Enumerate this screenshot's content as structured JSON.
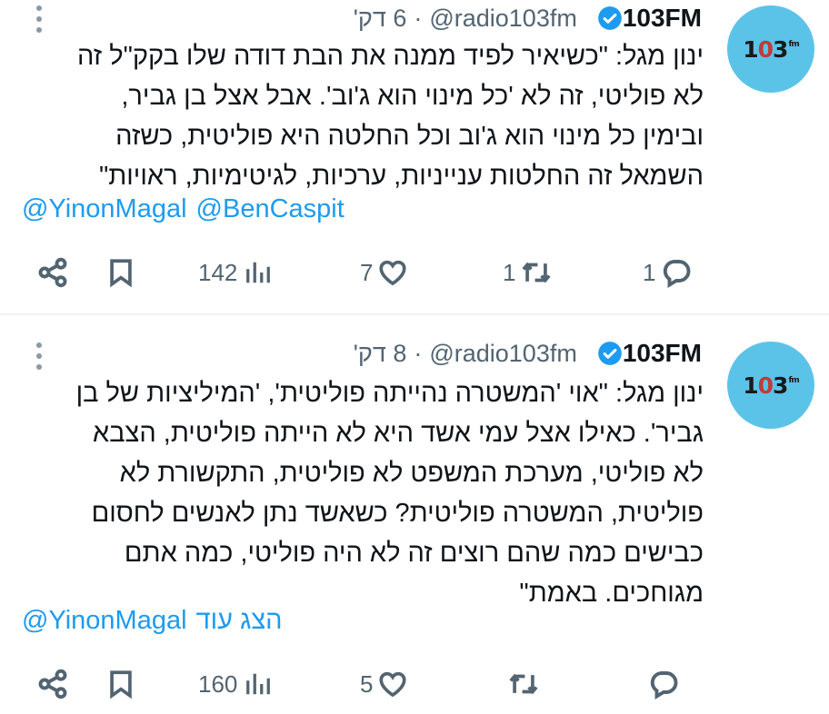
{
  "tweets": [
    {
      "author_name": "103FM",
      "handle": "@radio103fm",
      "separator": "·",
      "time": "6 דק'",
      "avatar_text": "103",
      "avatar_sup": "fm",
      "text": "ינון מגל: \"כשיאיר לפיד ממנה את הבת דודה שלו בקק\"ל זה\nלא פוליטי, זה לא 'כל מינוי הוא ג'וב'. אבל אצל בן גביר,\nובימין כל מינוי הוא ג'וב וכל החלטה היא פוליטית, כשזה\nהשמאל זה החלטות ענייניות, ערכיות, לגיטימיות, ראויות\"",
      "mentions": [
        "@YinonMagal",
        "@BenCaspit"
      ],
      "show_more": "",
      "views": "142",
      "likes": "7",
      "retweets": "1",
      "replies": "1"
    },
    {
      "author_name": "103FM",
      "handle": "@radio103fm",
      "separator": "·",
      "time": "8 דק'",
      "avatar_text": "103",
      "avatar_sup": "fm",
      "text": "ינון מגל: \"אוי 'המשטרה נהייתה פוליטית', 'המיליציות של בן\nגביר'. כאילו אצל עמי אשד היא לא הייתה פוליטית, הצבא\nלא פוליטי, מערכת המשפט לא פוליטית, התקשורת לא\nפוליטית, המשטרה פוליטית? כשאשד נתן לאנשים לחסום\nכבישים כמה שהם רוצים זה לא היה פוליטי, כמה אתם\nמגוחכים. באמת\"",
      "mentions": [
        "@YinonMagal"
      ],
      "show_more": "הצג עוד",
      "views": "160",
      "likes": "5",
      "retweets": "",
      "replies": ""
    }
  ],
  "colors": {
    "accent": "#1d9bf0",
    "muted": "#536471",
    "avatar_bg": "#5cc3e8",
    "verified": "#1d9bf0"
  },
  "icons": {
    "share": "share-icon",
    "bookmark": "bookmark-icon",
    "views": "views-icon",
    "like": "heart-icon",
    "retweet": "retweet-icon",
    "reply": "reply-icon",
    "verified": "verified-badge-icon",
    "more": "more-options-icon"
  }
}
